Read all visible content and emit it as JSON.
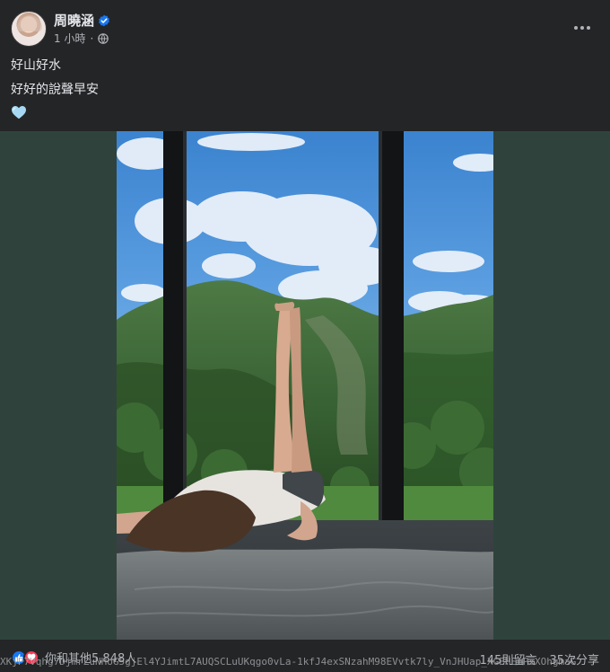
{
  "post": {
    "author": "周曉涵",
    "timestamp": "1 小時",
    "lines": [
      "好山好水",
      "好好的說聲早安"
    ],
    "emoji": "light-blue-heart"
  },
  "footer": {
    "reactions_text": "你和其他5,848人",
    "comments": "145則留言",
    "shares": "35次分享"
  },
  "overlay": {
    "url_fragment": "XKjP7Vqhg7DjmrZuNHoG5gjEl4YJimtL7AUQSCLuUKqgo0vLa-1kfJ4exSNzahM98EVvtk7ly_VnJHUap_XGEHEnPxXOhgmaG"
  },
  "colors": {
    "background": "#242526",
    "media_bg": "#2f433c",
    "text": "#e4e6eb",
    "secondary": "#b0b3b8",
    "verified": "#1877f2",
    "heart": "#a6d8f4"
  },
  "icons": [
    "verified-badge-icon",
    "globe-icon",
    "more-options-icon",
    "light-blue-heart-icon",
    "like-icon",
    "love-icon"
  ]
}
